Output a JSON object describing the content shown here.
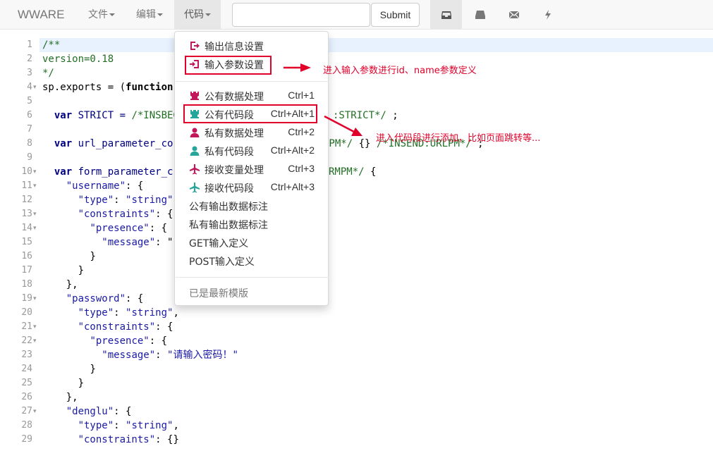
{
  "navbar": {
    "brand": "WWARE",
    "menus": [
      {
        "label": "文件"
      },
      {
        "label": "编辑"
      },
      {
        "label": "代码"
      }
    ],
    "search": {
      "value": "",
      "placeholder": ""
    },
    "submit_label": "Submit",
    "icons": [
      "inbox-icon",
      "hdd-icon",
      "envelope-icon",
      "flash-icon"
    ]
  },
  "editor": {
    "lines": [
      {
        "n": "1",
        "fold": false
      },
      {
        "n": "2",
        "fold": false
      },
      {
        "n": "3",
        "fold": false
      },
      {
        "n": "4",
        "fold": true
      },
      {
        "n": "5",
        "fold": false
      },
      {
        "n": "6",
        "fold": false
      },
      {
        "n": "7",
        "fold": false
      },
      {
        "n": "8",
        "fold": false
      },
      {
        "n": "9",
        "fold": false
      },
      {
        "n": "10",
        "fold": true
      },
      {
        "n": "11",
        "fold": true
      },
      {
        "n": "12",
        "fold": false
      },
      {
        "n": "13",
        "fold": true
      },
      {
        "n": "14",
        "fold": true
      },
      {
        "n": "15",
        "fold": false
      },
      {
        "n": "16",
        "fold": false
      },
      {
        "n": "17",
        "fold": false
      },
      {
        "n": "18",
        "fold": false
      },
      {
        "n": "19",
        "fold": true
      },
      {
        "n": "20",
        "fold": false
      },
      {
        "n": "21",
        "fold": true
      },
      {
        "n": "22",
        "fold": true
      },
      {
        "n": "23",
        "fold": false
      },
      {
        "n": "24",
        "fold": false
      },
      {
        "n": "25",
        "fold": false
      },
      {
        "n": "26",
        "fold": false
      },
      {
        "n": "27",
        "fold": true
      },
      {
        "n": "28",
        "fold": false
      },
      {
        "n": "29",
        "fold": false
      }
    ],
    "code": {
      "l1": "/**",
      "l2": "version=0.18",
      "l3": "*/",
      "l4a": "sp.exports = (",
      "l4b": "function",
      "l6a": "var",
      "l6b": " STRICT = ",
      "l6c": "/*INSBEG",
      "l6d": ":STRICT*/",
      "l6e": " ;",
      "l8a": "var",
      "l8b": " url_parameter_co",
      "l8c": "LPM*/",
      "l8d": " {} ",
      "l8e": "/*INSEND:URLPM*/",
      "l8f": " ;",
      "l10a": "var",
      "l10b": " form_parameter_c",
      "l10c": "RMPM*/",
      "l10d": " {",
      "l11a": "\"username\"",
      "l11b": ": {",
      "l12a": "\"type\"",
      "l12b": ": ",
      "l12c": "\"string\"",
      "l13a": "\"constraints\"",
      "l13b": ": {",
      "l14a": "\"presence\"",
      "l14b": ": {",
      "l15a": "\"message\"",
      "l15b": ": \"",
      "l16": "}",
      "l17": "}",
      "l18": "},",
      "l19a": "\"password\"",
      "l19b": ": {",
      "l20a": "\"type\"",
      "l20b": ": ",
      "l20c": "\"string\"",
      "l20d": ",",
      "l21a": "\"constraints\"",
      "l21b": ": {",
      "l22a": "\"presence\"",
      "l22b": ": {",
      "l23a": "\"message\"",
      "l23b": ": ",
      "l23c": "\"请输入密码！\"",
      "l24": "}",
      "l25": "}",
      "l26": "},",
      "l27a": "\"denglu\"",
      "l27b": ": {",
      "l28a": "\"type\"",
      "l28b": ": ",
      "l28c": "\"string\"",
      "l28d": ",",
      "l29a": "\"constraints\"",
      "l29b": ": {}"
    }
  },
  "dropdown": {
    "items": [
      {
        "label": "输出信息设置",
        "shortcut": "",
        "icon": "log-out-icon",
        "color": "#c2185b"
      },
      {
        "label": "输入参数设置",
        "shortcut": "",
        "icon": "log-in-icon",
        "color": "#c2185b"
      },
      {
        "label": "公有数据处理",
        "shortcut": "Ctrl+1",
        "icon": "tower-icon",
        "color": "#c2185b"
      },
      {
        "label": "公有代码段",
        "shortcut": "Ctrl+Alt+1",
        "icon": "tower-icon",
        "color": "#26a69a"
      },
      {
        "label": "私有数据处理",
        "shortcut": "Ctrl+2",
        "icon": "user-icon",
        "color": "#c2185b"
      },
      {
        "label": "私有代码段",
        "shortcut": "Ctrl+Alt+2",
        "icon": "user-icon",
        "color": "#26a69a"
      },
      {
        "label": "接收变量处理",
        "shortcut": "Ctrl+3",
        "icon": "plane-icon",
        "color": "#c2185b"
      },
      {
        "label": "接收代码段",
        "shortcut": "Ctrl+Alt+3",
        "icon": "plane-icon",
        "color": "#26a69a"
      },
      {
        "label": "公有输出数据标注",
        "shortcut": ""
      },
      {
        "label": "私有输出数据标注",
        "shortcut": ""
      },
      {
        "label": "GET输入定义",
        "shortcut": ""
      },
      {
        "label": "POST输入定义",
        "shortcut": ""
      },
      {
        "label": "已是最新模版",
        "shortcut": ""
      }
    ]
  },
  "annotations": {
    "input_params": "进入输入参数进行id、name参数定义",
    "public_code": "进入代码段进行添加，比如页面跳转等..."
  },
  "colors": {
    "annotation": "#e0002a",
    "magenta": "#c2185b",
    "teal": "#26a69a"
  }
}
